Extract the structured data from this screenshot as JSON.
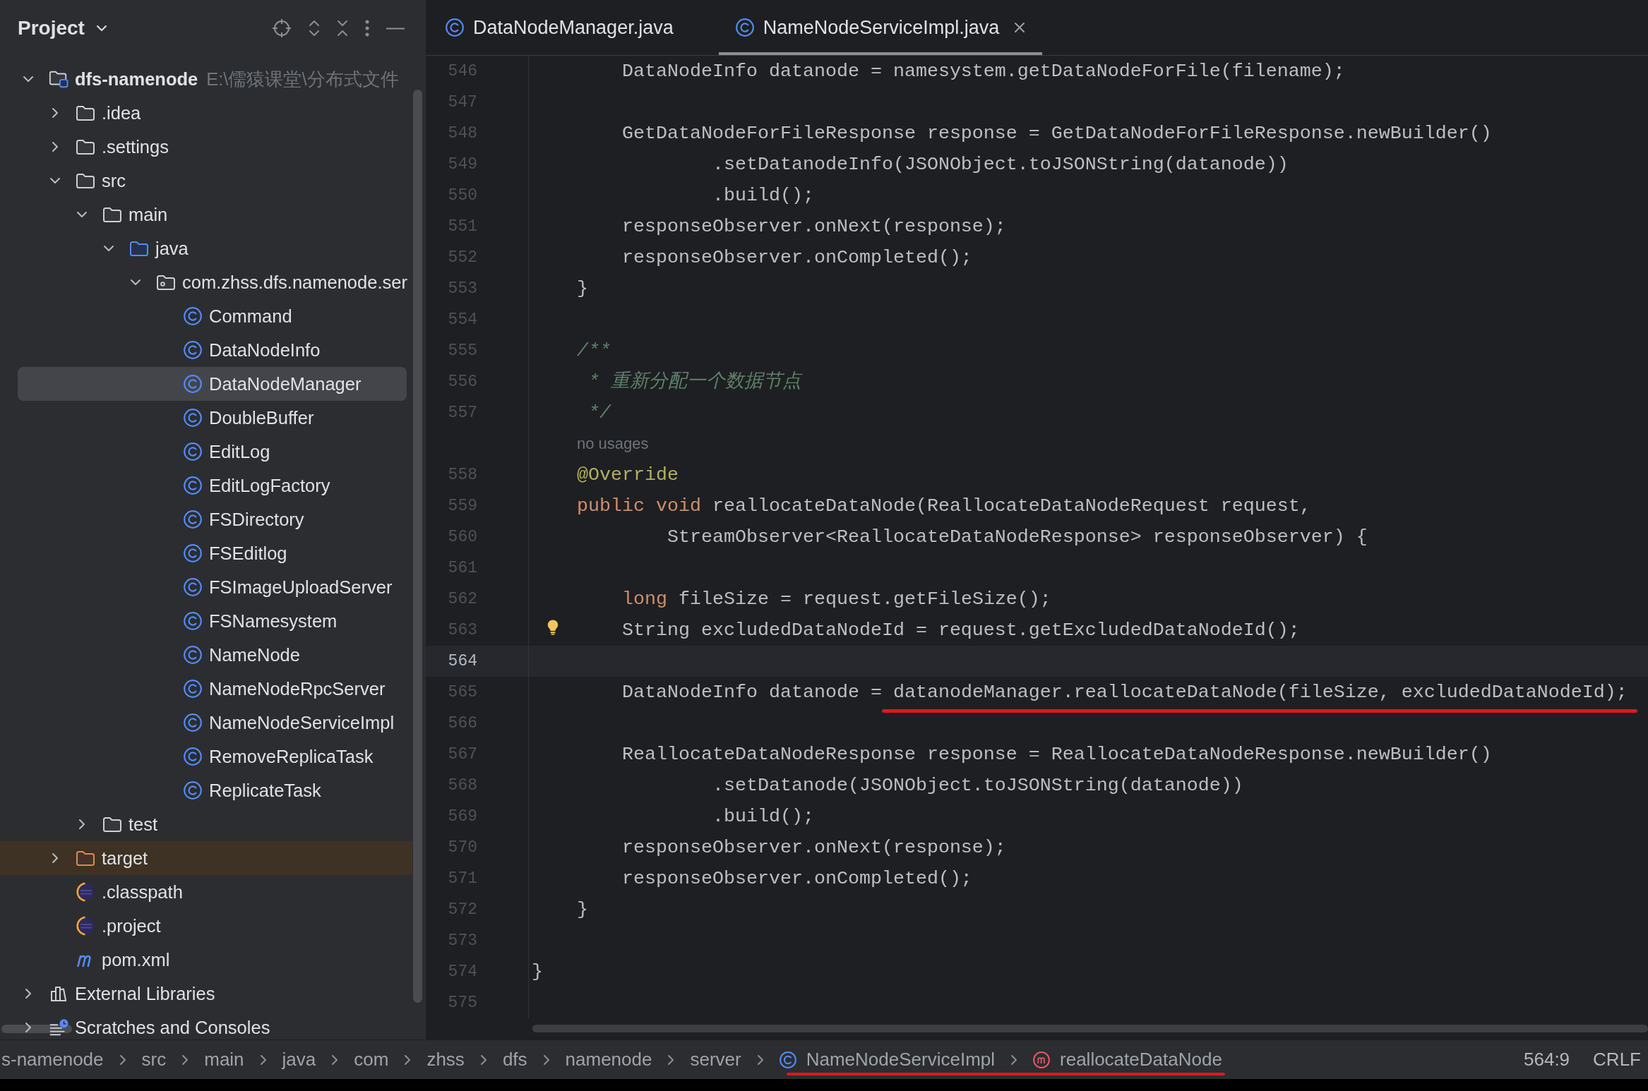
{
  "project_panel": {
    "title": "Project",
    "tree": [
      {
        "label": "dfs-namenode",
        "kind": "module",
        "path": "E:\\儒猿课堂\\分布式文件",
        "expanded": true,
        "selected": false,
        "children": [
          {
            "label": ".idea",
            "kind": "folder",
            "expanded": false,
            "selected": false
          },
          {
            "label": ".settings",
            "kind": "folder",
            "expanded": false,
            "selected": false
          },
          {
            "label": "src",
            "kind": "folder",
            "expanded": true,
            "selected": false,
            "children": [
              {
                "label": "main",
                "kind": "folder",
                "expanded": true,
                "selected": false,
                "children": [
                  {
                    "label": "java",
                    "kind": "source-folder",
                    "expanded": true,
                    "selected": false,
                    "children": [
                      {
                        "label": "com.zhss.dfs.namenode.ser",
                        "kind": "package",
                        "expanded": true,
                        "selected": false,
                        "children": [
                          {
                            "label": "Command",
                            "kind": "class",
                            "selected": false
                          },
                          {
                            "label": "DataNodeInfo",
                            "kind": "class",
                            "selected": false
                          },
                          {
                            "label": "DataNodeManager",
                            "kind": "class",
                            "selected": true
                          },
                          {
                            "label": "DoubleBuffer",
                            "kind": "class",
                            "selected": false
                          },
                          {
                            "label": "EditLog",
                            "kind": "class",
                            "selected": false
                          },
                          {
                            "label": "EditLogFactory",
                            "kind": "class",
                            "selected": false
                          },
                          {
                            "label": "FSDirectory",
                            "kind": "class",
                            "selected": false
                          },
                          {
                            "label": "FSEditlog",
                            "kind": "class",
                            "selected": false
                          },
                          {
                            "label": "FSImageUploadServer",
                            "kind": "class",
                            "selected": false
                          },
                          {
                            "label": "FSNamesystem",
                            "kind": "class",
                            "selected": false
                          },
                          {
                            "label": "NameNode",
                            "kind": "class",
                            "selected": false
                          },
                          {
                            "label": "NameNodeRpcServer",
                            "kind": "class",
                            "selected": false
                          },
                          {
                            "label": "NameNodeServiceImpl",
                            "kind": "class",
                            "selected": false
                          },
                          {
                            "label": "RemoveReplicaTask",
                            "kind": "class",
                            "selected": false
                          },
                          {
                            "label": "ReplicateTask",
                            "kind": "class",
                            "selected": false
                          }
                        ]
                      }
                    ]
                  }
                ]
              },
              {
                "label": "test",
                "kind": "folder",
                "expanded": false,
                "selected": false
              }
            ]
          },
          {
            "label": "target",
            "kind": "excluded-folder",
            "expanded": false,
            "selected": false
          },
          {
            "label": ".classpath",
            "kind": "eclipse-file",
            "selected": false
          },
          {
            "label": ".project",
            "kind": "eclipse-file",
            "selected": false
          },
          {
            "label": "pom.xml",
            "kind": "maven-file",
            "selected": false
          }
        ]
      },
      {
        "label": "External Libraries",
        "kind": "libraries",
        "expanded": false,
        "selected": false
      },
      {
        "label": "Scratches and Consoles",
        "kind": "scratches",
        "expanded": false,
        "selected": false
      }
    ]
  },
  "editor": {
    "tabs": [
      {
        "label": "DataNodeManager.java",
        "selected": false
      },
      {
        "label": "NameNodeServiceImpl.java",
        "selected": true
      }
    ],
    "lines": [
      {
        "kind": "code",
        "number": "546",
        "current": false,
        "bulb": false,
        "segments": [
          {
            "kind": "plain",
            "text": "        DataNodeInfo datanode = namesystem.getDataNodeForFile(filename);",
            "underlined": false
          }
        ]
      },
      {
        "kind": "code",
        "number": "547",
        "current": false,
        "bulb": false
      },
      {
        "kind": "code",
        "number": "548",
        "current": false,
        "bulb": false,
        "segments": [
          {
            "kind": "plain",
            "text": "        GetDataNodeForFileResponse response = GetDataNodeForFileResponse.newBuilder()",
            "underlined": false
          }
        ]
      },
      {
        "kind": "code",
        "number": "549",
        "current": false,
        "bulb": false,
        "segments": [
          {
            "kind": "plain",
            "text": "                .setDatanodeInfo(JSONObject.toJSONString(datanode))",
            "underlined": false
          }
        ]
      },
      {
        "kind": "code",
        "number": "550",
        "current": false,
        "bulb": false,
        "segments": [
          {
            "kind": "plain",
            "text": "                .build();",
            "underlined": false
          }
        ]
      },
      {
        "kind": "code",
        "number": "551",
        "current": false,
        "bulb": false,
        "segments": [
          {
            "kind": "plain",
            "text": "        responseObserver.onNext(response);",
            "underlined": false
          }
        ]
      },
      {
        "kind": "code",
        "number": "552",
        "current": false,
        "bulb": false,
        "segments": [
          {
            "kind": "plain",
            "text": "        responseObserver.onCompleted();",
            "underlined": false
          }
        ]
      },
      {
        "kind": "code",
        "number": "553",
        "current": false,
        "bulb": false,
        "segments": [
          {
            "kind": "plain",
            "text": "    }",
            "underlined": false
          }
        ]
      },
      {
        "kind": "code",
        "number": "554",
        "current": false,
        "bulb": false
      },
      {
        "kind": "code",
        "number": "555",
        "current": false,
        "bulb": false,
        "segments": [
          {
            "kind": "comment",
            "text": "    /**",
            "underlined": false
          }
        ]
      },
      {
        "kind": "code",
        "number": "556",
        "current": false,
        "bulb": false,
        "segments": [
          {
            "kind": "comment",
            "text": "     * 重新分配一个数据节点",
            "underlined": false
          }
        ]
      },
      {
        "kind": "code",
        "number": "557",
        "current": false,
        "bulb": false,
        "segments": [
          {
            "kind": "comment",
            "text": "     */",
            "underlined": false
          }
        ]
      },
      {
        "kind": "inlay",
        "text": "no usages"
      },
      {
        "kind": "code",
        "number": "558",
        "current": false,
        "bulb": false,
        "segments": [
          {
            "kind": "annotation",
            "text": "    @Override",
            "underlined": false
          }
        ]
      },
      {
        "kind": "code",
        "number": "559",
        "current": false,
        "bulb": false,
        "segments": [
          {
            "kind": "keyword",
            "text": "    public void",
            "underlined": false
          },
          {
            "kind": "plain",
            "text": " reallocateDataNode(ReallocateDataNodeRequest request,",
            "underlined": false
          }
        ]
      },
      {
        "kind": "code",
        "number": "560",
        "current": false,
        "bulb": false,
        "segments": [
          {
            "kind": "plain",
            "text": "            StreamObserver<ReallocateDataNodeResponse> responseObserver) {",
            "underlined": false
          }
        ]
      },
      {
        "kind": "code",
        "number": "561",
        "current": false,
        "bulb": false
      },
      {
        "kind": "code",
        "number": "562",
        "current": false,
        "bulb": false,
        "segments": [
          {
            "kind": "keyword",
            "text": "        long",
            "underlined": false
          },
          {
            "kind": "plain",
            "text": " fileSize = request.getFileSize();",
            "underlined": false
          }
        ]
      },
      {
        "kind": "code",
        "number": "563",
        "current": false,
        "bulb": true,
        "segments": [
          {
            "kind": "plain",
            "text": "        String excludedDataNodeId = request.getExcludedDataNodeId();",
            "underlined": false
          }
        ]
      },
      {
        "kind": "code",
        "number": "564",
        "current": true,
        "bulb": false
      },
      {
        "kind": "code",
        "number": "565",
        "current": false,
        "bulb": false,
        "segments": [
          {
            "kind": "plain",
            "text": "        DataNodeInfo datanode = ",
            "underlined": false
          },
          {
            "kind": "plain",
            "text": "datanodeManager.reallocateDataNode(fileSize, excludedDataNodeId);",
            "underlined": true
          }
        ]
      },
      {
        "kind": "code",
        "number": "566",
        "current": false,
        "bulb": false
      },
      {
        "kind": "code",
        "number": "567",
        "current": false,
        "bulb": false,
        "segments": [
          {
            "kind": "plain",
            "text": "        ReallocateDataNodeResponse response = ReallocateDataNodeResponse.newBuilder()",
            "underlined": false
          }
        ]
      },
      {
        "kind": "code",
        "number": "568",
        "current": false,
        "bulb": false,
        "segments": [
          {
            "kind": "plain",
            "text": "                .setDatanode(JSONObject.toJSONString(datanode))",
            "underlined": false
          }
        ]
      },
      {
        "kind": "code",
        "number": "569",
        "current": false,
        "bulb": false,
        "segments": [
          {
            "kind": "plain",
            "text": "                .build();",
            "underlined": false
          }
        ]
      },
      {
        "kind": "code",
        "number": "570",
        "current": false,
        "bulb": false,
        "segments": [
          {
            "kind": "plain",
            "text": "        responseObserver.onNext(response);",
            "underlined": false
          }
        ]
      },
      {
        "kind": "code",
        "number": "571",
        "current": false,
        "bulb": false,
        "segments": [
          {
            "kind": "plain",
            "text": "        responseObserver.onCompleted();",
            "underlined": false
          }
        ]
      },
      {
        "kind": "code",
        "number": "572",
        "current": false,
        "bulb": false,
        "segments": [
          {
            "kind": "plain",
            "text": "    }",
            "underlined": false
          }
        ]
      },
      {
        "kind": "code",
        "number": "573",
        "current": false,
        "bulb": false
      },
      {
        "kind": "code",
        "number": "574",
        "current": false,
        "bulb": false,
        "segments": [
          {
            "kind": "plain",
            "text": "}",
            "underlined": false
          }
        ]
      },
      {
        "kind": "code",
        "number": "575",
        "current": false,
        "bulb": false
      }
    ]
  },
  "status_bar": {
    "breadcrumbs": [
      {
        "label": "s-namenode",
        "kind": "path",
        "underlined": false
      },
      {
        "label": "src",
        "kind": "path",
        "underlined": false
      },
      {
        "label": "main",
        "kind": "path",
        "underlined": false
      },
      {
        "label": "java",
        "kind": "path",
        "underlined": false
      },
      {
        "label": "com",
        "kind": "path",
        "underlined": false
      },
      {
        "label": "zhss",
        "kind": "path",
        "underlined": false
      },
      {
        "label": "dfs",
        "kind": "path",
        "underlined": false
      },
      {
        "label": "namenode",
        "kind": "path",
        "underlined": false
      },
      {
        "label": "server",
        "kind": "path",
        "underlined": false
      },
      {
        "label": "NameNodeServiceImpl",
        "kind": "class",
        "underlined": true
      },
      {
        "label": "reallocateDataNode",
        "kind": "method",
        "underlined": true
      }
    ],
    "caret": "564:9",
    "line_separator": "CRLF"
  }
}
